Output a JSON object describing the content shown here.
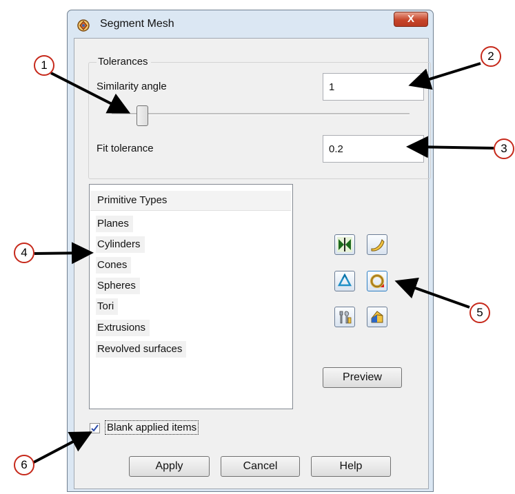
{
  "window": {
    "title": "Segment Mesh",
    "close_label": "X"
  },
  "tolerances": {
    "group_title": "Tolerances",
    "similarity_angle_label": "Similarity angle",
    "similarity_angle_value": "1",
    "fit_tolerance_label": "Fit tolerance",
    "fit_tolerance_value": "0.2"
  },
  "primitive_types": {
    "header": "Primitive Types",
    "items": [
      "Planes",
      "Cylinders",
      "Cones",
      "Spheres",
      "Tori",
      "Extrusions",
      "Revolved surfaces"
    ]
  },
  "tool_buttons": {
    "icons": [
      "mirror-icon",
      "curved-surface-icon",
      "recycle-icon",
      "ring-selection-icon",
      "wrench-tools-icon",
      "solid-shape-icon"
    ]
  },
  "buttons": {
    "preview": "Preview",
    "apply": "Apply",
    "cancel": "Cancel",
    "help": "Help"
  },
  "blank_applied_items": {
    "label": "Blank applied items",
    "checked": true
  },
  "callouts": [
    "1",
    "2",
    "3",
    "4",
    "5",
    "6"
  ],
  "colors": {
    "callout_border": "#c6281a",
    "arrow": "#000000",
    "window_frame": "#dbe7f3",
    "dialog_background": "#f0f0f0"
  }
}
